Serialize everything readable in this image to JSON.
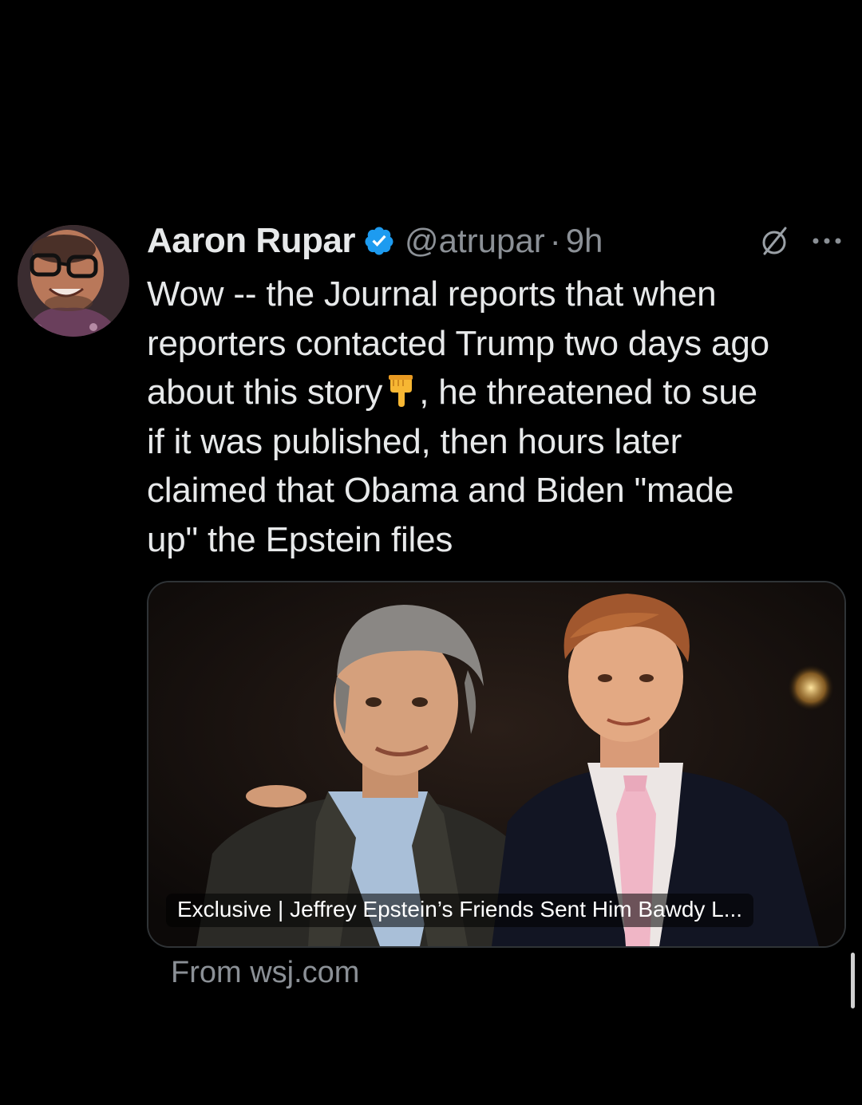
{
  "tweet": {
    "author_name": "Aaron Rupar",
    "handle": "@atrupar",
    "separator": "·",
    "time": "9h",
    "text_lines": [
      "Wow -- the Journal reports that when",
      "reporters contacted Trump two days ago",
      "about this story",
      ", he threatened to sue",
      "if it was published, then hours later",
      "claimed that Obama and Biden \"made",
      "up\" the Epstein files"
    ]
  },
  "card": {
    "headline": "Exclusive | Jeffrey Epstein’s Friends Sent Him Bawdy L...",
    "source": "From wsj.com"
  },
  "icons": {
    "verified": "verified-badge-icon",
    "grok": "grok-icon",
    "more": "more-options-icon",
    "emoji": "backhand-index-pointing-down-emoji"
  },
  "colors": {
    "background": "#000000",
    "text_primary": "#e7e9ea",
    "text_secondary": "#8b9096",
    "verified_blue": "#1d9bf0",
    "card_border": "#2f3336"
  }
}
